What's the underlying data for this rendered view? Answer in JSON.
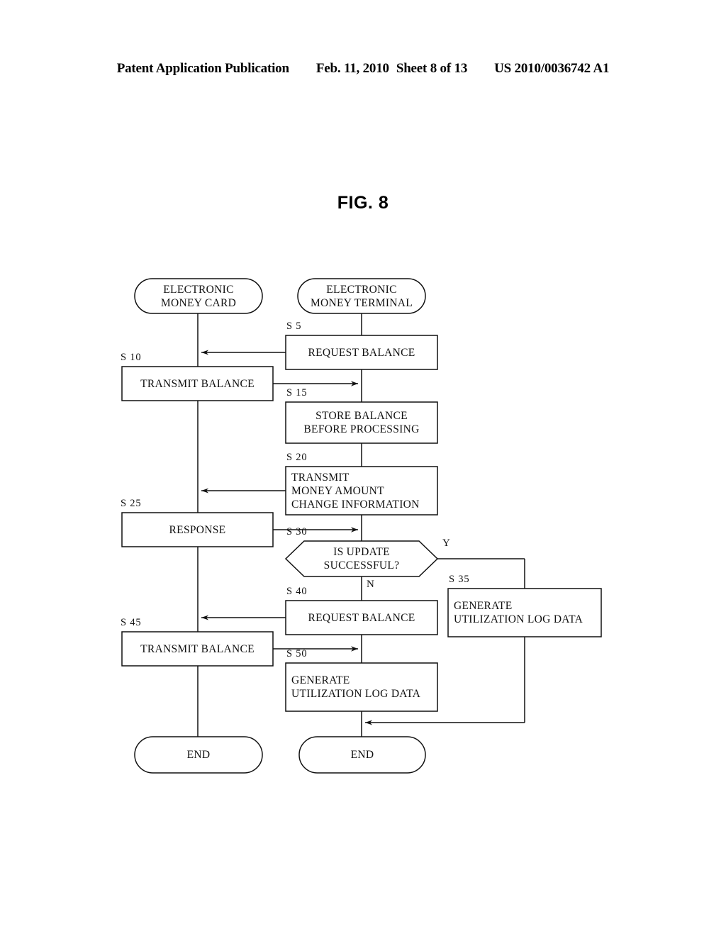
{
  "header": {
    "publication": "Patent Application Publication",
    "date": "Feb. 11, 2010",
    "sheet": "Sheet 8 of 13",
    "number": "US 2010/0036742 A1"
  },
  "figure": {
    "title": "FIG. 8",
    "ink_color": "#111111",
    "background": "#ffffff"
  },
  "flowchart": {
    "type": "flowchart",
    "lanes": [
      {
        "id": "card",
        "title": "ELECTRONIC\nMONEY CARD"
      },
      {
        "id": "terminal",
        "title": "ELECTRONIC\nMONEY TERMINAL"
      }
    ],
    "terminals": {
      "start_card_line1": "ELECTRONIC",
      "start_card_line2": "MONEY CARD",
      "start_terminal_line1": "ELECTRONIC",
      "start_terminal_line2": "MONEY TERMINAL",
      "end_card": "END",
      "end_terminal": "END"
    },
    "steps": [
      {
        "id": "S5",
        "label": "S 5",
        "text": "REQUEST BALANCE",
        "lane": "terminal",
        "shape": "process",
        "align": "center"
      },
      {
        "id": "S10",
        "label": "S 10",
        "text": "TRANSMIT BALANCE",
        "lane": "card",
        "shape": "process",
        "align": "center"
      },
      {
        "id": "S15",
        "label": "S 15",
        "text_line1": "STORE BALANCE",
        "text_line2": "BEFORE PROCESSING",
        "lane": "terminal",
        "shape": "process",
        "align": "center"
      },
      {
        "id": "S20",
        "label": "S 20",
        "text_line1": "TRANSMIT",
        "text_line2": "MONEY AMOUNT",
        "text_line3": "CHANGE INFORMATION",
        "lane": "terminal",
        "shape": "process",
        "align": "left"
      },
      {
        "id": "S25",
        "label": "S 25",
        "text": "RESPONSE",
        "lane": "card",
        "shape": "process",
        "align": "center"
      },
      {
        "id": "S30",
        "label": "S 30",
        "text_line1": "IS UPDATE",
        "text_line2": "SUCCESSFUL?",
        "lane": "terminal",
        "shape": "decision",
        "align": "center"
      },
      {
        "id": "S35",
        "label": "S 35",
        "text_line1": "GENERATE",
        "text_line2": "UTILIZATION LOG DATA",
        "lane": "right",
        "shape": "process",
        "align": "left"
      },
      {
        "id": "S40",
        "label": "S 40",
        "text": "REQUEST BALANCE",
        "lane": "terminal",
        "shape": "process",
        "align": "center"
      },
      {
        "id": "S45",
        "label": "S 45",
        "text": "TRANSMIT BALANCE",
        "lane": "card",
        "shape": "process",
        "align": "center"
      },
      {
        "id": "S50",
        "label": "S 50",
        "text_line1": "GENERATE",
        "text_line2": "UTILIZATION LOG DATA",
        "lane": "terminal",
        "shape": "process",
        "align": "left"
      }
    ],
    "branch_labels": {
      "yes": "Y",
      "no": "N"
    }
  }
}
